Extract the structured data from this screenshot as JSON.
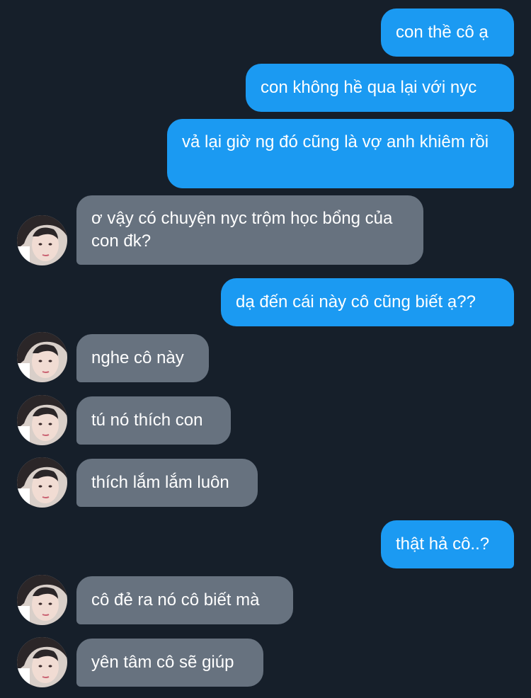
{
  "messages": [
    {
      "direction": "outgoing",
      "text": "con thề cô ạ"
    },
    {
      "direction": "outgoing",
      "text": "con không hề qua lại với nyc"
    },
    {
      "direction": "outgoing",
      "text": "vả lại giờ ng đó cũng là vợ anh khiêm rồi"
    },
    {
      "direction": "incoming",
      "text": "ơ vậy có chuyện nyc trộm học bổng của con đk?",
      "avatar": "contact-avatar"
    },
    {
      "direction": "outgoing",
      "text": "dạ đến cái này cô cũng biết ạ??"
    },
    {
      "direction": "incoming",
      "text": "nghe cô này",
      "avatar": "contact-avatar"
    },
    {
      "direction": "incoming",
      "text": "tú nó thích con",
      "avatar": "contact-avatar"
    },
    {
      "direction": "incoming",
      "text": "thích lắm lắm luôn",
      "avatar": "contact-avatar"
    },
    {
      "direction": "outgoing",
      "text": "thật hả cô..?"
    },
    {
      "direction": "incoming",
      "text": "cô đẻ ra nó cô biết mà",
      "avatar": "contact-avatar"
    },
    {
      "direction": "incoming",
      "text": "yên tâm cô sẽ giúp",
      "avatar": "contact-avatar"
    }
  ],
  "colors": {
    "background": "#161f2a",
    "outgoing_bubble": "#1b9af2",
    "incoming_bubble": "#67727f",
    "text": "#ffffff"
  }
}
